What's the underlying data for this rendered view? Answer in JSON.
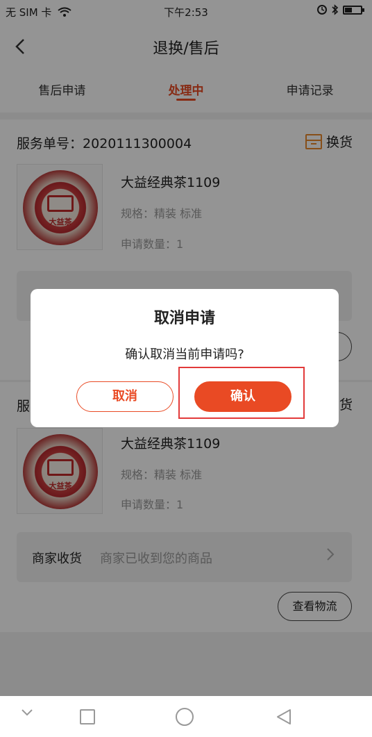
{
  "status_bar": {
    "carrier": "无 SIM 卡",
    "time": "下午2:53",
    "battery_level": 0.45,
    "icons": [
      "wifi-icon",
      "alarm-icon",
      "bluetooth-icon",
      "battery-icon"
    ]
  },
  "header": {
    "back_icon": "chevron-left-icon",
    "title": "退换/售后"
  },
  "tabs": [
    {
      "label": "售后申请",
      "active": false
    },
    {
      "label": "处理中",
      "active": true
    },
    {
      "label": "申请记录",
      "active": false
    }
  ],
  "orders": [
    {
      "service_label": "服务单号：",
      "service_number": "2020111300004",
      "service_type": "换货",
      "product_name": "大益经典茶1109",
      "spec": "规格：精装 标准",
      "quantity": "申请数量：1",
      "thumb_text": "大益茶"
    },
    {
      "service_label": "服",
      "service_type": "货",
      "product_name": "大益经典茶1109",
      "spec": "规格：精装 标准",
      "quantity": "申请数量：1",
      "thumb_text": "大益茶",
      "status_title": "商家收货",
      "status_desc": "商家已收到您的商品",
      "logistics_button": "查看物流"
    }
  ],
  "dialog": {
    "title": "取消申请",
    "message": "确认取消当前申请吗?",
    "cancel_label": "取消",
    "confirm_label": "确认"
  },
  "colors": {
    "accent": "#e94a24",
    "overlay": "rgba(0,0,0,0.42)",
    "highlight": "#e23a3a"
  }
}
